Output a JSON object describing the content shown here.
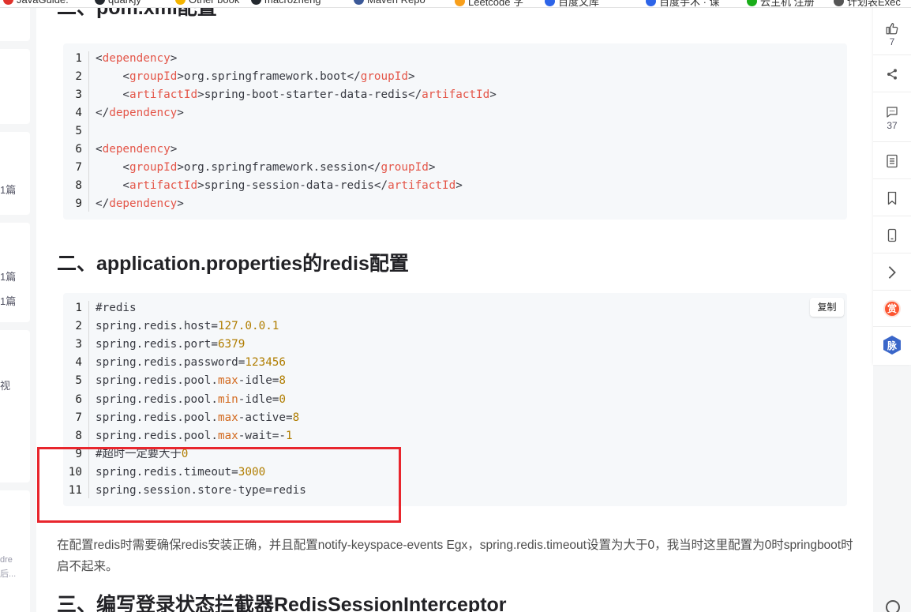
{
  "bookmarks": [
    {
      "label": "JavaGuide:",
      "color": "#e0322c"
    },
    {
      "label": "quarkjy",
      "color": "#24292f"
    },
    {
      "label": "Other book",
      "color": "#f4b400"
    },
    {
      "label": "macrozheng",
      "color": "#24292f"
    },
    {
      "label": "Maven Repo",
      "color": "#3b5998"
    },
    {
      "label": "Leetcode 字",
      "color": "#f89f1b"
    },
    {
      "label": "百度文库",
      "color": "#2d64e8"
    },
    {
      "label": "百度手术 · 课",
      "color": "#2d64e8"
    },
    {
      "label": "云主机 注册",
      "color": "#1aad19"
    },
    {
      "label": "计划表Exec",
      "color": "#555555"
    }
  ],
  "left_sidebar": {
    "fragments": [
      "1篇",
      "1篇",
      "1篇",
      "视",
      "dre",
      "后..."
    ]
  },
  "headings": {
    "h_pom": "二、pom.xml配置",
    "h_props": "二、application.properties的redis配置",
    "h_interceptor": "三、编写登录状态拦截器RedisSessionInterceptor"
  },
  "pom_code": [
    {
      "n": "1",
      "segments": [
        {
          "t": "<",
          "c": "p"
        },
        {
          "t": "dependency",
          "c": "tag"
        },
        {
          "t": ">",
          "c": "p"
        }
      ]
    },
    {
      "n": "2",
      "segments": [
        {
          "t": "    <",
          "c": "p"
        },
        {
          "t": "groupId",
          "c": "tag"
        },
        {
          "t": ">org.springframework.boot</",
          "c": "p"
        },
        {
          "t": "groupId",
          "c": "tag"
        },
        {
          "t": ">",
          "c": "p"
        }
      ]
    },
    {
      "n": "3",
      "segments": [
        {
          "t": "    <",
          "c": "p"
        },
        {
          "t": "artifactId",
          "c": "tag"
        },
        {
          "t": ">spring-boot-starter-data-redis</",
          "c": "p"
        },
        {
          "t": "artifactId",
          "c": "tag"
        },
        {
          "t": ">",
          "c": "p"
        }
      ]
    },
    {
      "n": "4",
      "segments": [
        {
          "t": "</",
          "c": "p"
        },
        {
          "t": "dependency",
          "c": "tag"
        },
        {
          "t": ">",
          "c": "p"
        }
      ]
    },
    {
      "n": "5",
      "segments": []
    },
    {
      "n": "6",
      "segments": [
        {
          "t": "<",
          "c": "p"
        },
        {
          "t": "dependency",
          "c": "tag"
        },
        {
          "t": ">",
          "c": "p"
        }
      ]
    },
    {
      "n": "7",
      "segments": [
        {
          "t": "    <",
          "c": "p"
        },
        {
          "t": "groupId",
          "c": "tag"
        },
        {
          "t": ">org.springframework.session</",
          "c": "p"
        },
        {
          "t": "groupId",
          "c": "tag"
        },
        {
          "t": ">",
          "c": "p"
        }
      ]
    },
    {
      "n": "8",
      "segments": [
        {
          "t": "    <",
          "c": "p"
        },
        {
          "t": "artifactId",
          "c": "tag"
        },
        {
          "t": ">spring-session-data-redis</",
          "c": "p"
        },
        {
          "t": "artifactId",
          "c": "tag"
        },
        {
          "t": ">",
          "c": "p"
        }
      ]
    },
    {
      "n": "9",
      "segments": [
        {
          "t": "</",
          "c": "p"
        },
        {
          "t": "dependency",
          "c": "tag"
        },
        {
          "t": ">",
          "c": "p"
        }
      ]
    }
  ],
  "props_code": [
    {
      "n": "1",
      "segments": [
        {
          "t": "#redis",
          "c": "p"
        }
      ]
    },
    {
      "n": "2",
      "segments": [
        {
          "t": "spring.redis.host=",
          "c": "p"
        },
        {
          "t": "127.0.0.1",
          "c": "num"
        }
      ]
    },
    {
      "n": "3",
      "segments": [
        {
          "t": "spring.redis.port=",
          "c": "p"
        },
        {
          "t": "6379",
          "c": "num"
        }
      ]
    },
    {
      "n": "4",
      "segments": [
        {
          "t": "spring.redis.password=",
          "c": "p"
        },
        {
          "t": "123456",
          "c": "num"
        }
      ]
    },
    {
      "n": "5",
      "segments": [
        {
          "t": "spring.redis.pool.",
          "c": "p"
        },
        {
          "t": "max",
          "c": "kw2"
        },
        {
          "t": "-idle=",
          "c": "p"
        },
        {
          "t": "8",
          "c": "num"
        }
      ]
    },
    {
      "n": "6",
      "segments": [
        {
          "t": "spring.redis.pool.",
          "c": "p"
        },
        {
          "t": "min",
          "c": "kw2"
        },
        {
          "t": "-idle=",
          "c": "p"
        },
        {
          "t": "0",
          "c": "num"
        }
      ]
    },
    {
      "n": "7",
      "segments": [
        {
          "t": "spring.redis.pool.",
          "c": "p"
        },
        {
          "t": "max",
          "c": "kw2"
        },
        {
          "t": "-active=",
          "c": "p"
        },
        {
          "t": "8",
          "c": "num"
        }
      ]
    },
    {
      "n": "8",
      "segments": [
        {
          "t": "spring.redis.pool.",
          "c": "p"
        },
        {
          "t": "max",
          "c": "kw2"
        },
        {
          "t": "-wait=-",
          "c": "p"
        },
        {
          "t": "1",
          "c": "num"
        }
      ]
    },
    {
      "n": "9",
      "segments": [
        {
          "t": "#超时一定要大于",
          "c": "p"
        },
        {
          "t": "0",
          "c": "num"
        }
      ]
    },
    {
      "n": "10",
      "segments": [
        {
          "t": "spring.redis.timeout=",
          "c": "p"
        },
        {
          "t": "3000",
          "c": "num"
        }
      ]
    },
    {
      "n": "11",
      "segments": [
        {
          "t": "spring.session.store-type=redis",
          "c": "p"
        }
      ]
    }
  ],
  "copy_label": "复制",
  "paragraph": "在配置redis时需要确保redis安装正确，并且配置notify-keyspace-events Egx，spring.redis.timeout设置为大于0，我当时这里配置为0时springboot时启不起来。",
  "toolbar": {
    "like_count": "7",
    "comment_count": "37",
    "reward_label": "赏",
    "network_label": "脉"
  },
  "colors": {
    "highlight_box": "#e8262d",
    "tag": "#e45649",
    "number": "#b07d00"
  }
}
